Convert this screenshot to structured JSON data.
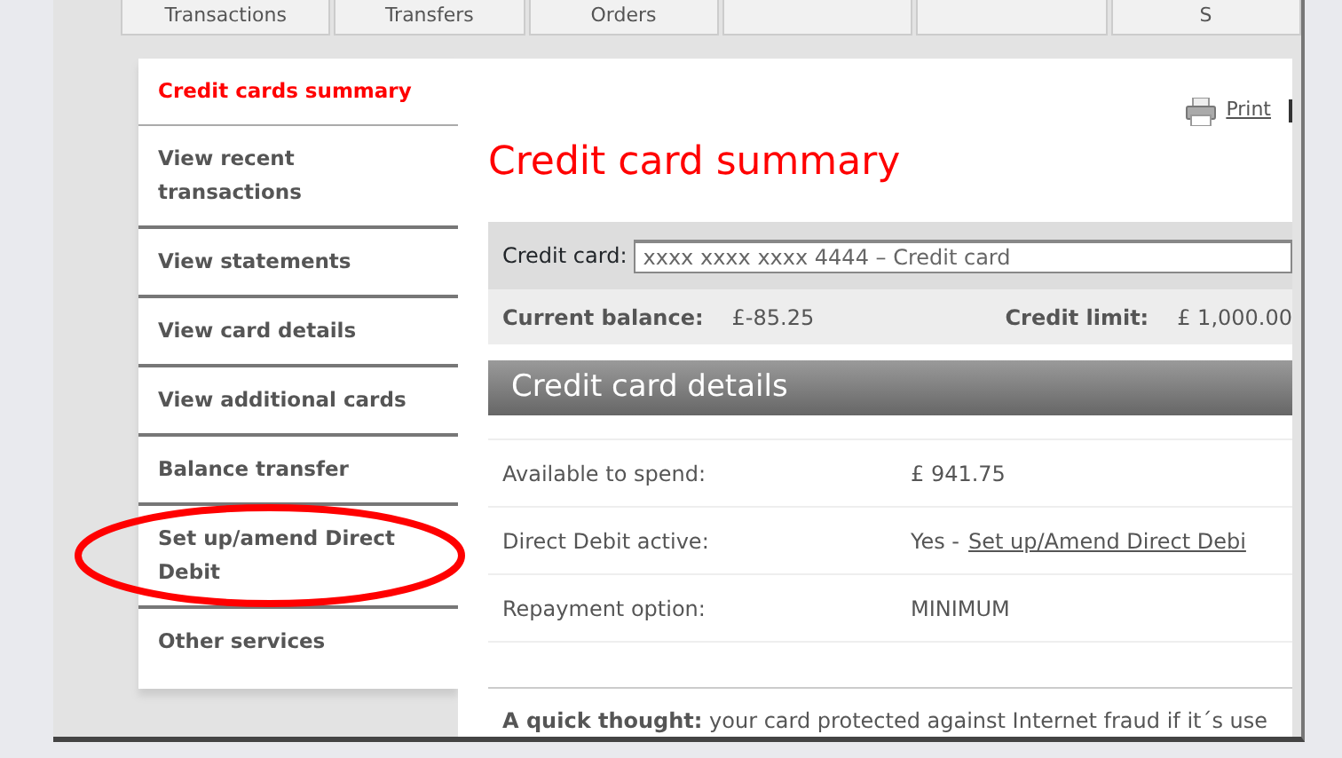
{
  "tabs": [
    {
      "label": "Transactions"
    },
    {
      "label": "Transfers"
    },
    {
      "label": "Orders"
    },
    {
      "kind": "blank"
    },
    {
      "kind": "blank"
    },
    {
      "label": "S"
    }
  ],
  "sidebar": {
    "items": [
      {
        "label": "Credit cards summary",
        "selected": true
      },
      {
        "label": "View recent transactions",
        "selected": false
      },
      {
        "label": "View statements",
        "selected": false
      },
      {
        "label": "View card details",
        "selected": false
      },
      {
        "label": "View additional cards",
        "selected": false
      },
      {
        "label": "Balance transfer",
        "selected": false
      },
      {
        "label": "Set up/amend Direct Debit",
        "selected": false,
        "annotated": true
      },
      {
        "label": "Other services",
        "selected": false
      }
    ]
  },
  "print_link": "Print",
  "page_title": "Credit card summary",
  "card_select": {
    "label": "Credit card:",
    "value": "xxxx xxxx xxxx 4444 – Credit card"
  },
  "balance": {
    "current_label": "Current balance:",
    "current_value": "£-85.25",
    "limit_label": "Credit limit:",
    "limit_value": "£ 1,000.00"
  },
  "details": {
    "title": "Credit card details",
    "rows": [
      {
        "label": "Available to spend:",
        "value": "£ 941.75"
      },
      {
        "label": "Direct Debit active:",
        "value": "Yes -",
        "link": "Set up/Amend Direct Debi"
      },
      {
        "label": "Repayment option:",
        "value": "MINIMUM"
      }
    ]
  },
  "note": "**A quick thought:** your card protected against Internet fraud if it´s use"
}
